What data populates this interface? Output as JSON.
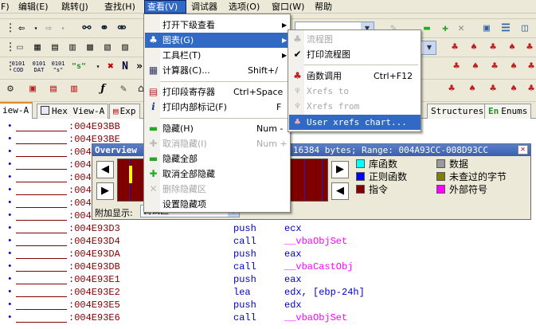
{
  "menubar": {
    "items": [
      {
        "label": "F)"
      },
      {
        "label": "编辑(E)"
      },
      {
        "label": "跳转(J)"
      },
      {
        "label": "查找(H)"
      },
      {
        "label": "查看(V)"
      },
      {
        "label": "调试器"
      },
      {
        "label": "选项(O)"
      },
      {
        "label": "窗口(W)"
      },
      {
        "label": "帮助"
      }
    ]
  },
  "toolbar": {
    "row3": {
      "b1": "0101\nCOD",
      "b2": "0101\nDAT",
      "b3": "0101\n\"s\"",
      "b4": "\"s\""
    }
  },
  "view_menu": {
    "items": [
      {
        "label": "打开下级查看",
        "shortcut": ""
      },
      {
        "label": "图表(G)",
        "shortcut": ""
      },
      {
        "label": "工具栏(T)",
        "shortcut": ""
      },
      {
        "label": "计算器(C)...",
        "shortcut": "Shift+/"
      },
      {
        "label": "打印段寄存器",
        "shortcut": "Ctrl+Space"
      },
      {
        "label": "打印内部标记(F)",
        "shortcut": "F"
      },
      {
        "label": "隐藏(H)",
        "shortcut": "Num -"
      },
      {
        "label": "取消隐藏(I)",
        "shortcut": "Num +"
      },
      {
        "label": "隐藏全部",
        "shortcut": ""
      },
      {
        "label": "取消全部隐藏",
        "shortcut": ""
      },
      {
        "label": "删除隐藏区",
        "shortcut": ""
      },
      {
        "label": "设置隐藏项",
        "shortcut": ""
      }
    ]
  },
  "graph_submenu": {
    "items": [
      {
        "label": "流程图",
        "shortcut": ""
      },
      {
        "label": "打印流程图",
        "shortcut": ""
      },
      {
        "label": "函数调用",
        "shortcut": "Ctrl+F12"
      },
      {
        "label": "Xrefs to",
        "shortcut": ""
      },
      {
        "label": "Xrefs from",
        "shortcut": ""
      },
      {
        "label": "User xrefs chart...",
        "shortcut": ""
      }
    ]
  },
  "tabs": [
    {
      "label": "iew-A"
    },
    {
      "label": "Hex View-A"
    },
    {
      "label": "Exp"
    },
    {
      "label": "Structures"
    },
    {
      "label": "Enums"
    }
  ],
  "overview": {
    "title": "Overview",
    "info": "16384 bytes; Range: 004A93CC-008D93CC",
    "extra_label": "附加显示:",
    "extra_value": "调试区",
    "legend": [
      {
        "label": "库函数",
        "color": "#00ffff"
      },
      {
        "label": "数据",
        "color": "#9a9a9a"
      },
      {
        "label": "正则函数",
        "color": "#0000ff"
      },
      {
        "label": "未查过的字节",
        "color": "#808000"
      },
      {
        "label": "指令",
        "color": "#800000"
      },
      {
        "label": "外部符号",
        "color": "#ff00ff"
      }
    ]
  },
  "code_rows": [
    {
      "addr": ":004E93BB",
      "mn": "",
      "op": ""
    },
    {
      "addr": ":004E93BE",
      "mn": "",
      "op": ""
    },
    {
      "addr": ":004E93C1",
      "mn": "",
      "op": ""
    },
    {
      "addr": ":004E93C4",
      "mn": "",
      "op": ""
    },
    {
      "addr": ":004E93C7",
      "mn": "",
      "op": ""
    },
    {
      "addr": ":004E93CA",
      "mn": "",
      "op": ""
    },
    {
      "addr": ":004E93CD",
      "mn": "",
      "op": ""
    },
    {
      "addr": ":004E93D0",
      "mn": "",
      "op": ""
    },
    {
      "addr": ":004E93D3",
      "mn": "push",
      "op": "ecx"
    },
    {
      "addr": ":004E93D4",
      "mn": "call",
      "op": "__vbaObjSet"
    },
    {
      "addr": ":004E93DA",
      "mn": "push",
      "op": "eax"
    },
    {
      "addr": ":004E93DB",
      "mn": "call",
      "op": "__vbaCastObj"
    },
    {
      "addr": ":004E93E1",
      "mn": "push",
      "op": "eax"
    },
    {
      "addr": ":004E93E2",
      "mn": "lea",
      "op": "edx, [ebp-24h]"
    },
    {
      "addr": ":004E93E5",
      "mn": "push",
      "op": "edx"
    },
    {
      "addr": ":004E93E6",
      "mn": "call",
      "op": "__vbaObjSet"
    }
  ]
}
